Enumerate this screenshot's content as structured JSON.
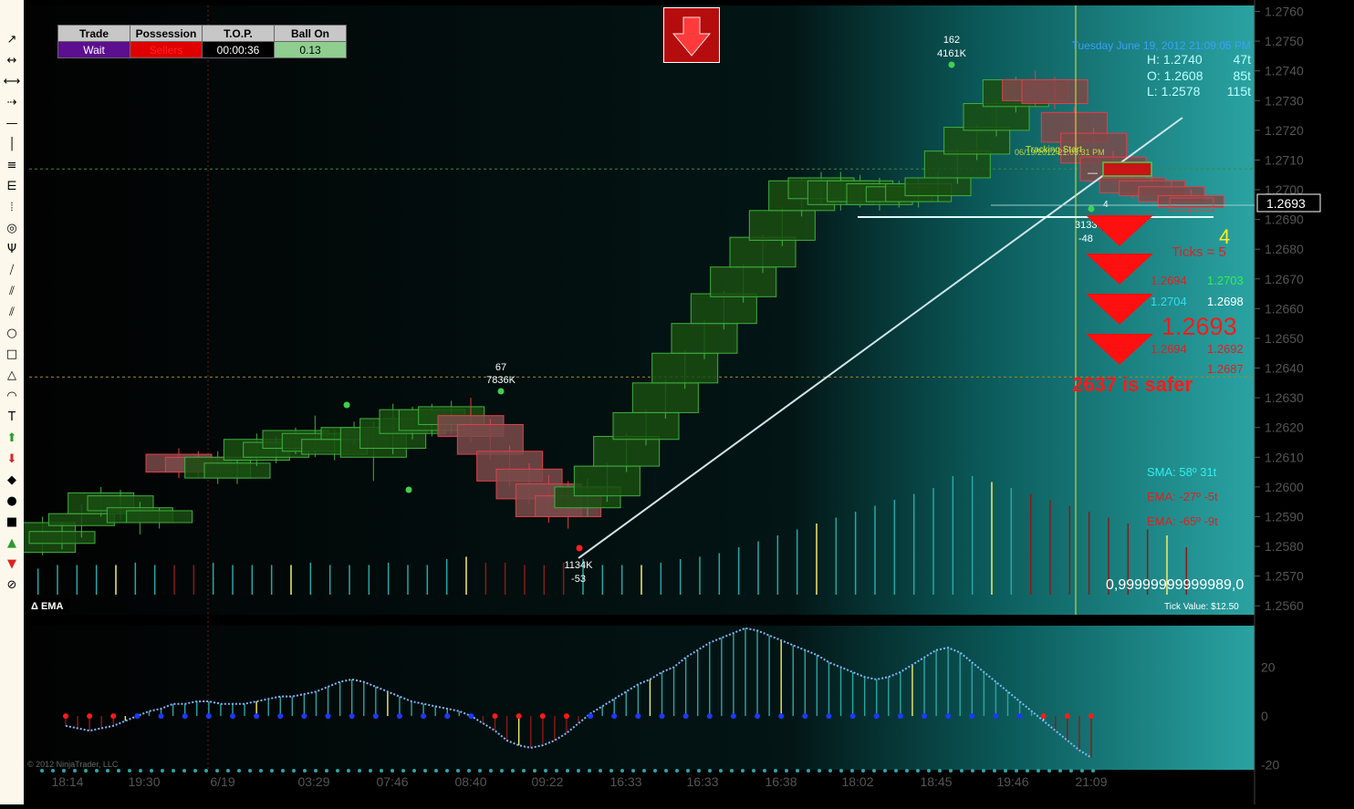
{
  "toolbar": {
    "tools": [
      "line-icon",
      "ray-icon",
      "extended-line-icon",
      "arrow-line-icon",
      "horizontal-line-icon",
      "vertical-line-icon",
      "fib-retracement-icon",
      "fib-extension-icon",
      "fib-time-icon",
      "fib-circle-icon",
      "andrews-pitchfork-icon",
      "gann-fan-icon",
      "regression-channel-icon",
      "trend-channel-icon",
      "ellipse-icon",
      "rectangle-icon",
      "triangle-icon",
      "arc-icon",
      "text-icon",
      "arrow-up-icon",
      "arrow-down-icon",
      "diamond-icon",
      "dot-icon",
      "square-icon",
      "triangle-up-icon",
      "triangle-down-icon",
      "stop-icon"
    ],
    "glyphs": [
      "↗",
      "↔",
      "⟷",
      "⇢",
      "—",
      "│",
      "≡",
      "⋿",
      "⦙",
      "◎",
      "Ψ",
      "⧸",
      "⫽",
      "⫽",
      "○",
      "□",
      "△",
      "◠",
      "T",
      "⬆",
      "⬇",
      "◆",
      "●",
      "■",
      "▲",
      "▼",
      "⊘"
    ]
  },
  "panel": {
    "headers": [
      "Trade",
      "Possession",
      "T.O.P.",
      "Ball On"
    ],
    "values": [
      "Wait",
      "Sellers",
      "00:00:36",
      "0.13"
    ],
    "colors": [
      "#5c0f8f",
      "#e00000",
      "#000000",
      "#8fce8f"
    ],
    "text_colors": [
      "#ffffff",
      "#ff2020",
      "#ffffff",
      "#000000"
    ]
  },
  "info": {
    "date": "Tuesday June 19, 2012 21:09:05 PM",
    "rows": [
      {
        "label": "H: 1.2740",
        "ticks": "47t"
      },
      {
        "label": "O: 1.2608",
        "ticks": "85t"
      },
      {
        "label": "L: 1.2578",
        "ticks": "115t"
      }
    ]
  },
  "annotations": {
    "high_count": "162",
    "high_vol": "4161K",
    "mid_count": "67",
    "mid_vol": "7836K",
    "low_vol": "1134K",
    "low_delta": "-53",
    "last_vol": "3133",
    "last_delta": "-48",
    "last_small": "4",
    "big_four": "4",
    "ticks_label": "Ticks = 5",
    "levels": [
      {
        "a": "1.2694",
        "b": "1.2703"
      },
      {
        "a": "1.2704",
        "b": "1.2698"
      }
    ],
    "big_price": "1.2693",
    "levels2": [
      {
        "a": "1.2694",
        "b": "1.2692"
      },
      {
        "a": "",
        "b": "1.2687"
      }
    ],
    "safer": "2637 is safer",
    "tracking": "Tracking Start",
    "tracking_time": "06/19/2012 21:03:31 PM",
    "sma": "SMA: 58º  31t",
    "ema1": "EMA: -27º  -5t",
    "ema2": "EMA: -65º  -9t",
    "value_readout": "0,99999999999989,0",
    "tick_value": "Tick Value: $12.50",
    "indicator_name": "Δ EMA",
    "copyright": "© 2012 NinjaTrader, LLC",
    "price_box": "1.2693"
  },
  "colors": {
    "bull": "#1a4d12",
    "bull_edge": "#3fb03f",
    "bear": "#7a4a4a",
    "bear_edge": "#e0404a",
    "teal": "#2aa6a6",
    "accent_red": "#ff1a1a",
    "axis_text": "#555555"
  },
  "chart_data": [
    {
      "type": "candlestick",
      "title": "",
      "y_axis": {
        "ticks": [
          1.276,
          1.275,
          1.274,
          1.273,
          1.272,
          1.271,
          1.27,
          1.269,
          1.268,
          1.267,
          1.266,
          1.265,
          1.264,
          1.263,
          1.262,
          1.261,
          1.26,
          1.259,
          1.258,
          1.257,
          1.256
        ],
        "range": [
          1.2557,
          1.2762
        ]
      },
      "x_axis": {
        "labels": [
          "18:14",
          "19:30",
          "6/19",
          "03:29",
          "07:46",
          "08:40",
          "09:22",
          "16:33",
          "16:33",
          "16:38",
          "18:02",
          "18:45",
          "19:46",
          "21:09"
        ]
      },
      "bars": [
        {
          "i": 0,
          "o": 1.2578,
          "c": 1.2588,
          "h": 1.259,
          "l": 1.2577
        },
        {
          "i": 1,
          "o": 1.2581,
          "c": 1.2585,
          "h": 1.2588,
          "l": 1.2579
        },
        {
          "i": 2,
          "o": 1.2587,
          "c": 1.2591,
          "h": 1.2594,
          "l": 1.2583
        },
        {
          "i": 3,
          "o": 1.2591,
          "c": 1.2598,
          "h": 1.26,
          "l": 1.259
        },
        {
          "i": 4,
          "o": 1.2592,
          "c": 1.2597,
          "h": 1.2599,
          "l": 1.2589
        },
        {
          "i": 5,
          "o": 1.2588,
          "c": 1.2593,
          "h": 1.2595,
          "l": 1.2584
        },
        {
          "i": 6,
          "o": 1.2588,
          "c": 1.2592,
          "h": 1.2593,
          "l": 1.2586
        },
        {
          "i": 7,
          "o": 1.2611,
          "c": 1.2605,
          "h": 1.2613,
          "l": 1.2603
        },
        {
          "i": 8,
          "o": 1.261,
          "c": 1.2605,
          "h": 1.2612,
          "l": 1.2603
        },
        {
          "i": 9,
          "o": 1.2603,
          "c": 1.261,
          "h": 1.2612,
          "l": 1.2601
        },
        {
          "i": 10,
          "o": 1.2603,
          "c": 1.2608,
          "h": 1.2609,
          "l": 1.2601
        },
        {
          "i": 11,
          "o": 1.2609,
          "c": 1.2616,
          "h": 1.2618,
          "l": 1.2607
        },
        {
          "i": 12,
          "o": 1.261,
          "c": 1.2615,
          "h": 1.2617,
          "l": 1.2608
        },
        {
          "i": 13,
          "o": 1.2613,
          "c": 1.2619,
          "h": 1.262,
          "l": 1.2611
        },
        {
          "i": 14,
          "o": 1.2612,
          "c": 1.2618,
          "h": 1.2624,
          "l": 1.261
        },
        {
          "i": 15,
          "o": 1.2611,
          "c": 1.2616,
          "h": 1.2619,
          "l": 1.2609
        },
        {
          "i": 16,
          "o": 1.2616,
          "c": 1.262,
          "h": 1.2622,
          "l": 1.2614
        },
        {
          "i": 17,
          "o": 1.261,
          "c": 1.262,
          "h": 1.2622,
          "l": 1.2602
        },
        {
          "i": 18,
          "o": 1.2613,
          "c": 1.2623,
          "h": 1.2628,
          "l": 1.2611
        },
        {
          "i": 19,
          "o": 1.2618,
          "c": 1.2626,
          "h": 1.2627,
          "l": 1.2616
        },
        {
          "i": 20,
          "o": 1.2619,
          "c": 1.2626,
          "h": 1.2628,
          "l": 1.2617
        },
        {
          "i": 21,
          "o": 1.2621,
          "c": 1.2627,
          "h": 1.2629,
          "l": 1.2618
        },
        {
          "i": 22,
          "o": 1.2624,
          "c": 1.2617,
          "h": 1.263,
          "l": 1.2615
        },
        {
          "i": 23,
          "o": 1.2621,
          "c": 1.2611,
          "h": 1.2623,
          "l": 1.2609
        },
        {
          "i": 24,
          "o": 1.2612,
          "c": 1.2602,
          "h": 1.2614,
          "l": 1.26
        },
        {
          "i": 25,
          "o": 1.2606,
          "c": 1.2596,
          "h": 1.2608,
          "l": 1.2594
        },
        {
          "i": 26,
          "o": 1.2601,
          "c": 1.259,
          "h": 1.2604,
          "l": 1.2588
        },
        {
          "i": 27,
          "o": 1.2597,
          "c": 1.259,
          "h": 1.2602,
          "l": 1.2586
        },
        {
          "i": 28,
          "o": 1.2593,
          "c": 1.26,
          "h": 1.2603,
          "l": 1.259
        },
        {
          "i": 29,
          "o": 1.2597,
          "c": 1.2607,
          "h": 1.2608,
          "l": 1.2595
        },
        {
          "i": 30,
          "o": 1.2607,
          "c": 1.2617,
          "h": 1.2618,
          "l": 1.2605
        },
        {
          "i": 31,
          "o": 1.2616,
          "c": 1.2625,
          "h": 1.2626,
          "l": 1.2614
        },
        {
          "i": 32,
          "o": 1.2625,
          "c": 1.2635,
          "h": 1.2636,
          "l": 1.2623
        },
        {
          "i": 33,
          "o": 1.2635,
          "c": 1.2645,
          "h": 1.2646,
          "l": 1.2633
        },
        {
          "i": 34,
          "o": 1.2645,
          "c": 1.2655,
          "h": 1.2656,
          "l": 1.2643
        },
        {
          "i": 35,
          "o": 1.2655,
          "c": 1.2665,
          "h": 1.2666,
          "l": 1.2653
        },
        {
          "i": 36,
          "o": 1.2664,
          "c": 1.2674,
          "h": 1.2675,
          "l": 1.2662
        },
        {
          "i": 37,
          "o": 1.2674,
          "c": 1.2684,
          "h": 1.2685,
          "l": 1.2672
        },
        {
          "i": 38,
          "o": 1.2683,
          "c": 1.2693,
          "h": 1.2694,
          "l": 1.2681
        },
        {
          "i": 39,
          "o": 1.2693,
          "c": 1.2703,
          "h": 1.2704,
          "l": 1.2691
        },
        {
          "i": 40,
          "o": 1.2697,
          "c": 1.2704,
          "h": 1.2706,
          "l": 1.2695
        },
        {
          "i": 41,
          "o": 1.2695,
          "c": 1.2703,
          "h": 1.2706,
          "l": 1.2693
        },
        {
          "i": 42,
          "o": 1.2696,
          "c": 1.2703,
          "h": 1.2705,
          "l": 1.2694
        },
        {
          "i": 43,
          "o": 1.2695,
          "c": 1.2702,
          "h": 1.2704,
          "l": 1.2693
        },
        {
          "i": 44,
          "o": 1.2696,
          "c": 1.2701,
          "h": 1.2703,
          "l": 1.2694
        },
        {
          "i": 45,
          "o": 1.2696,
          "c": 1.2702,
          "h": 1.2704,
          "l": 1.2694
        },
        {
          "i": 46,
          "o": 1.2698,
          "c": 1.2704,
          "h": 1.2706,
          "l": 1.2696
        },
        {
          "i": 47,
          "o": 1.2704,
          "c": 1.2713,
          "h": 1.2714,
          "l": 1.2702
        },
        {
          "i": 48,
          "o": 1.2712,
          "c": 1.2721,
          "h": 1.2722,
          "l": 1.271
        },
        {
          "i": 49,
          "o": 1.272,
          "c": 1.2729,
          "h": 1.273,
          "l": 1.2718
        },
        {
          "i": 50,
          "o": 1.2728,
          "c": 1.2737,
          "h": 1.2738,
          "l": 1.2726
        },
        {
          "i": 51,
          "o": 1.2737,
          "c": 1.273,
          "h": 1.274,
          "l": 1.2728
        },
        {
          "i": 52,
          "o": 1.2737,
          "c": 1.2729,
          "h": 1.2738,
          "l": 1.2727
        },
        {
          "i": 53,
          "o": 1.2726,
          "c": 1.2716,
          "h": 1.2728,
          "l": 1.2714
        },
        {
          "i": 54,
          "o": 1.2719,
          "c": 1.2709,
          "h": 1.2721,
          "l": 1.2707
        },
        {
          "i": 55,
          "o": 1.2711,
          "c": 1.2703,
          "h": 1.2713,
          "l": 1.2701
        },
        {
          "i": 56,
          "o": 1.2704,
          "c": 1.2699,
          "h": 1.2706,
          "l": 1.2697
        },
        {
          "i": 57,
          "o": 1.2703,
          "c": 1.2698,
          "h": 1.2705,
          "l": 1.2696
        },
        {
          "i": 58,
          "o": 1.2701,
          "c": 1.2696,
          "h": 1.2703,
          "l": 1.2694
        },
        {
          "i": 59,
          "o": 1.2698,
          "c": 1.2694,
          "h": 1.27,
          "l": 1.2692
        }
      ],
      "volume": [
        22,
        25,
        25,
        25,
        25,
        27,
        25,
        25,
        25,
        27,
        25,
        25,
        25,
        25,
        27,
        25,
        25,
        25,
        27,
        25,
        25,
        30,
        32,
        27,
        27,
        25,
        25,
        27,
        30,
        25,
        25,
        25,
        27,
        30,
        32,
        35,
        40,
        45,
        50,
        55,
        60,
        65,
        70,
        75,
        80,
        85,
        90,
        100,
        100,
        95,
        90,
        85,
        80,
        75,
        70,
        65,
        60,
        55,
        50,
        40
      ],
      "horizontal_levels": [
        1.2707,
        1.2637,
        1.2693,
        1.2689
      ]
    },
    {
      "type": "line",
      "title": "",
      "name": "Δ EMA",
      "y_axis": {
        "ticks": [
          20,
          0,
          -20
        ],
        "range": [
          -22,
          37
        ]
      },
      "values": [
        -4,
        -5,
        -6,
        -5,
        -4,
        -2,
        0,
        2,
        3,
        5,
        5,
        6,
        6,
        5,
        5,
        5,
        6,
        7,
        8,
        8,
        9,
        10,
        12,
        14,
        15,
        14,
        12,
        10,
        8,
        6,
        5,
        4,
        3,
        2,
        0,
        -3,
        -6,
        -10,
        -12,
        -13,
        -12,
        -10,
        -7,
        -3,
        1,
        4,
        7,
        10,
        13,
        15,
        18,
        20,
        24,
        27,
        30,
        32,
        34,
        36,
        35,
        33,
        31,
        29,
        27,
        25,
        22,
        20,
        18,
        16,
        15,
        16,
        18,
        21,
        24,
        27,
        28,
        26,
        22,
        18,
        14,
        10,
        6,
        2,
        -2,
        -6,
        -10,
        -14,
        -17
      ],
      "signal_dots": "alternating red/blue at zero line"
    }
  ]
}
